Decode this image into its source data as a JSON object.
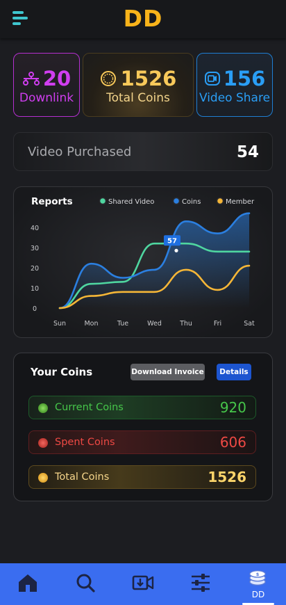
{
  "header": {
    "logo": "DD",
    "menu_icon": "hamburger-menu-icon"
  },
  "stats": [
    {
      "value": "20",
      "label": "Downlink",
      "icon": "downlink-icon",
      "color": "#d03ef0"
    },
    {
      "value": "1526",
      "label": "Total Coins",
      "icon": "coin-icon",
      "color": "#f8c95a"
    },
    {
      "value": "156",
      "label": "Video Share",
      "icon": "video-share-icon",
      "color": "#2a9ef5"
    }
  ],
  "video_purchased": {
    "label": "Video Purchased",
    "value": "54"
  },
  "reports": {
    "title": "Reports",
    "tooltip": "57"
  },
  "chart_data": {
    "type": "line",
    "title": "Reports",
    "categories": [
      "Sun",
      "Mon",
      "Tue",
      "Wed",
      "Thu",
      "Fri",
      "Sat"
    ],
    "y_ticks": [
      "0",
      "10",
      "20",
      "30",
      "40"
    ],
    "ylim": [
      0,
      50
    ],
    "legend_position": "top-right",
    "grid": false,
    "series": [
      {
        "name": "Shared Video",
        "color": "#4fd6a0",
        "values": [
          0,
          12,
          13,
          32,
          32,
          28,
          28
        ]
      },
      {
        "name": "Coins",
        "color": "#2b7fe0",
        "values": [
          0,
          22,
          15,
          19,
          43,
          37,
          47
        ]
      },
      {
        "name": "Member",
        "color": "#f5b637",
        "values": [
          0,
          6,
          8,
          8,
          19,
          9,
          21
        ]
      }
    ],
    "annotation": {
      "series": "Coins",
      "category": "Thu",
      "value": 57
    }
  },
  "coins": {
    "title": "Your Coins",
    "download_label": "Download Invoice",
    "details_label": "Details",
    "rows": [
      {
        "label": "Current Coins",
        "value": "920",
        "color": "#46c64a"
      },
      {
        "label": "Spent Coins",
        "value": "606",
        "color": "#ee4944"
      },
      {
        "label": "Total Coins",
        "value": "1526",
        "color": "#fbd46a"
      }
    ]
  },
  "nav": {
    "items": [
      "home-icon",
      "search-icon",
      "video-upload-icon",
      "sliders-icon",
      "coins-stack-icon"
    ],
    "active_label": "DD"
  }
}
